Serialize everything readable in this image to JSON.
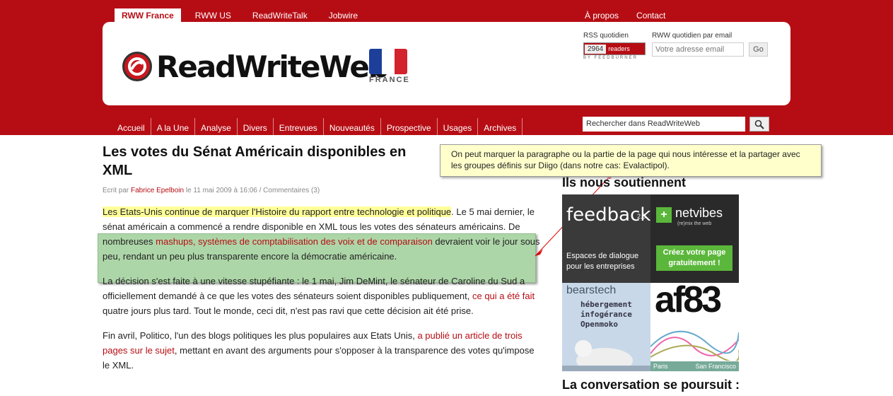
{
  "top_nav": {
    "tabs": [
      "RWW France",
      "RWW US",
      "ReadWriteTalk",
      "Jobwire"
    ],
    "right_links": [
      "À propos",
      "Contact"
    ]
  },
  "header": {
    "logo_text": "ReadWriteWeb",
    "logo_subtitle": "FRANCE",
    "rss_label": "RSS quotidien",
    "rss_count": "2964",
    "rss_readers": "readers",
    "feedburner": "BY FEEDBURNER",
    "email_label": "RWW quotidien par email",
    "email_placeholder": "Votre adresse email",
    "go_label": "Go"
  },
  "main_nav": [
    "Accueil",
    "A la Une",
    "Analyse",
    "Divers",
    "Entrevues",
    "Nouveautés",
    "Prospective",
    "Usages",
    "Archives"
  ],
  "search": {
    "placeholder": "Rechercher dans ReadWriteWeb"
  },
  "article": {
    "title": "Les votes du Sénat Américain disponibles en XML",
    "meta_prefix": "Ecrit par",
    "author": "Fabrice Epelboin",
    "meta_suffix": "le 11 mai 2009 à 16:06 / Commentaires (3)",
    "p1_highlight": "Les Etats-Unis continue de marquer l'Histoire du rapport entre technologie et politique",
    "p1_rest_a": ". Le 5 mai dernier, le sénat américain a commencé a rendre disponible en XML tous les votes des sénateurs américains. De nombreuses ",
    "p1_link": "mashups, systèmes de comptabilisation des voix et de comparaison",
    "p1_rest_b": " devraient voir le jour sous peu, rendant un peu plus transparente encore la démocratie américaine.",
    "p2_a": "La décision s'est faite à une vitesse stupéfiante : le 1 mai, Jim DeMint, le sénateur de Caroline du Sud a officiellement demandé à ce que les votes des sénateurs soient disponibles publiquement, ",
    "p2_link": "ce qui a été fait",
    "p2_b": " quatre jours plus tard. Tout le monde, ceci dit, n'est pas ravi que cette décision ait été prise.",
    "p3_a": "Fin avril, Politico, l'un des blogs politiques les plus populaires aux Etats Unis, ",
    "p3_link": "a publié un article de trois pages sur le sujet",
    "p3_b": ", mettant en avant des arguments pour s'opposer à la transparence des votes qu'impose le XML."
  },
  "tooltip": "On peut marquer la paragraphe ou la partie de la page qui nous intéresse et la partager avec les groupes définis sur Diigo (dans notre cas: Evalactipol).",
  "sidebar": {
    "sponsors_title": "Ils nous soutiennent",
    "ad1": {
      "brand": "feedback",
      "version": "2.0",
      "text": "Espaces de dialogue pour les entreprises"
    },
    "ad2": {
      "brand": "netvibes",
      "sub": "(re)mix the web",
      "cta": "Créez votre page gratuitement !"
    },
    "ad3": {
      "brand": "bearstech",
      "text": "hébergement infogérance Openmoko"
    },
    "ad4": {
      "brand": "af83",
      "city1": "Paris",
      "city2": "San Francisco"
    },
    "conversation_title": "La conversation se poursuit :"
  },
  "colors": {
    "brand_red": "#b60d14",
    "highlight_yellow": "#ffff99",
    "note_green": "#9fcf99",
    "tooltip_bg": "#ffffcc"
  }
}
